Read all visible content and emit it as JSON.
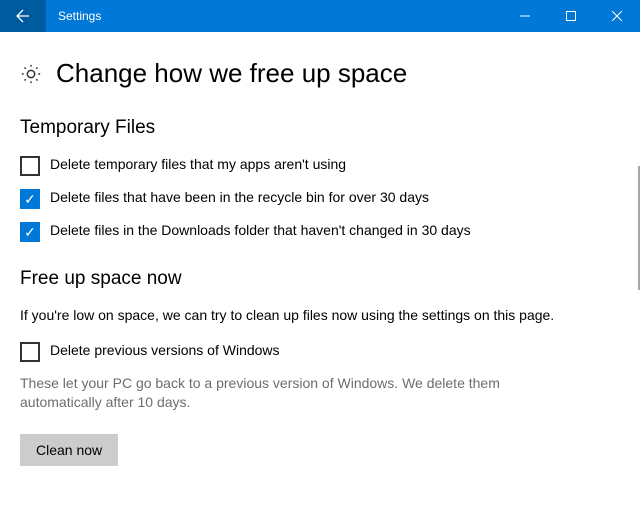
{
  "app_title": "Settings",
  "page_title": "Change how we free up space",
  "sections": {
    "temp": {
      "title": "Temporary Files",
      "options": [
        {
          "label": "Delete temporary files that my apps aren't using",
          "checked": false
        },
        {
          "label": "Delete files that have been in the recycle bin for over 30 days",
          "checked": true
        },
        {
          "label": "Delete files in the Downloads folder that haven't changed in 30 days",
          "checked": true
        }
      ]
    },
    "now": {
      "title": "Free up space now",
      "desc": "If you're low on space, we can try to clean up files now using the settings on this page.",
      "option": {
        "label": "Delete previous versions of Windows",
        "checked": false
      },
      "hint": "These let your PC go back to a previous version of Windows. We delete them automatically after 10 days.",
      "button": "Clean now"
    }
  }
}
